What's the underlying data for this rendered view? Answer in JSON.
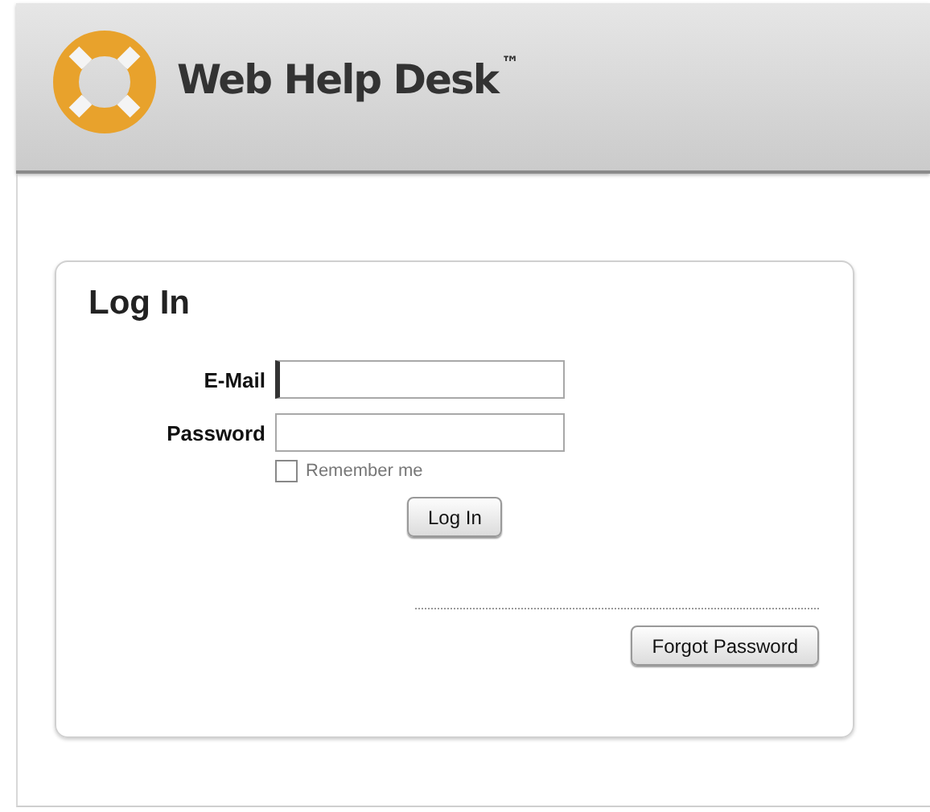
{
  "header": {
    "logo_text": "Web Help Desk$^{™}$"
  },
  "login": {
    "title": "Log In",
    "fields": [
      {
        "label": "E-Mail",
        "focused": true
      },
      {
        "label": "Password",
        "focused": false
      }
    ],
    "remember": {
      "label": "Remember me",
      "checked": false
    },
    "submit": "Log In",
    "forgot": "Forgot Password"
  }
}
